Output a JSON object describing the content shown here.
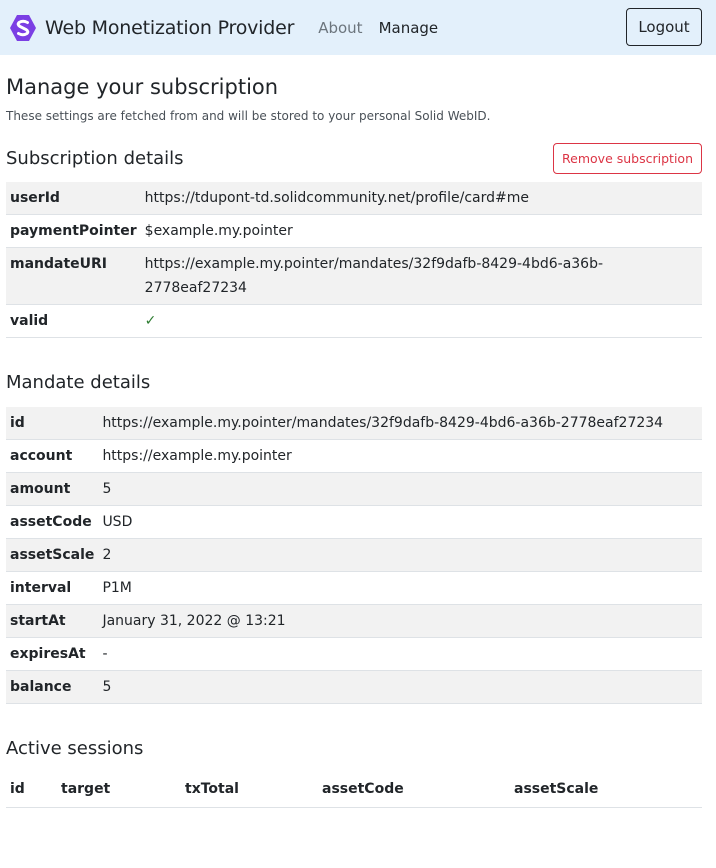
{
  "nav": {
    "brand": "Web Monetization Provider",
    "links": [
      "About",
      "Manage"
    ],
    "logout_label": "Logout"
  },
  "page": {
    "title": "Manage your subscription",
    "subtitle": "These settings are fetched from and will be stored to your personal Solid WebID."
  },
  "subscription": {
    "heading": "Subscription details",
    "remove_label": "Remove subscription",
    "rows": [
      {
        "key": "userId",
        "value": "https://tdupont-td.solidcommunity.net/profile/card#me"
      },
      {
        "key": "paymentPointer",
        "value": "$example.my.pointer"
      },
      {
        "key": "mandateURI",
        "value": "https://example.my.pointer/mandates/32f9dafb-8429-4bd6-a36b-2778eaf27234"
      },
      {
        "key": "valid",
        "value": "✓"
      }
    ]
  },
  "mandate": {
    "heading": "Mandate details",
    "rows": [
      {
        "key": "id",
        "value": "https://example.my.pointer/mandates/32f9dafb-8429-4bd6-a36b-2778eaf27234"
      },
      {
        "key": "account",
        "value": "https://example.my.pointer"
      },
      {
        "key": "amount",
        "value": "5"
      },
      {
        "key": "assetCode",
        "value": "USD"
      },
      {
        "key": "assetScale",
        "value": "2"
      },
      {
        "key": "interval",
        "value": "P1M"
      },
      {
        "key": "startAt",
        "value": "January 31, 2022 @ 13:21"
      },
      {
        "key": "expiresAt",
        "value": "-"
      },
      {
        "key": "balance",
        "value": "5"
      }
    ]
  },
  "sessions": {
    "heading": "Active sessions",
    "columns": [
      "id",
      "target",
      "txTotal",
      "assetCode",
      "assetScale"
    ]
  },
  "colors": {
    "navbar_bg": "#e3f0fb",
    "logo_purple": "#7b3fe4",
    "danger": "#dc3545",
    "valid_check": "#2e7d32"
  }
}
